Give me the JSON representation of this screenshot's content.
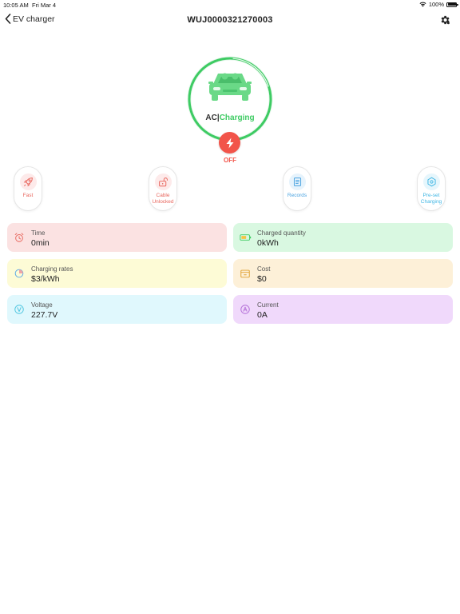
{
  "status_bar": {
    "time": "10:05 AM",
    "date": "Fri Mar 4",
    "battery": "100%"
  },
  "nav": {
    "back_label": "EV charger",
    "title": "WUJ0000321270003"
  },
  "charger": {
    "mode": "AC",
    "separator": "|",
    "status": "Charging",
    "power_state": "OFF"
  },
  "actions": [
    {
      "label": "Fast",
      "icon": "rocket-icon"
    },
    {
      "label": "Cable\nUnlocked",
      "icon": "unlocked-icon"
    },
    {
      "label": "Records",
      "icon": "records-icon"
    },
    {
      "label": "Pre-set\nCharging",
      "icon": "preset-icon"
    }
  ],
  "cards": {
    "time": {
      "label": "Time",
      "value": "0min"
    },
    "charged_quantity": {
      "label": "Charged quantity",
      "value": "0kWh"
    },
    "charging_rates": {
      "label": "Charging rates",
      "value": "$3/kWh"
    },
    "cost": {
      "label": "Cost",
      "value": "$0"
    },
    "voltage": {
      "label": "Voltage",
      "value": "227.7V"
    },
    "current": {
      "label": "Current",
      "value": "0A"
    }
  },
  "colors": {
    "accent_green": "#3ecb63",
    "power_red": "#f2544a"
  }
}
